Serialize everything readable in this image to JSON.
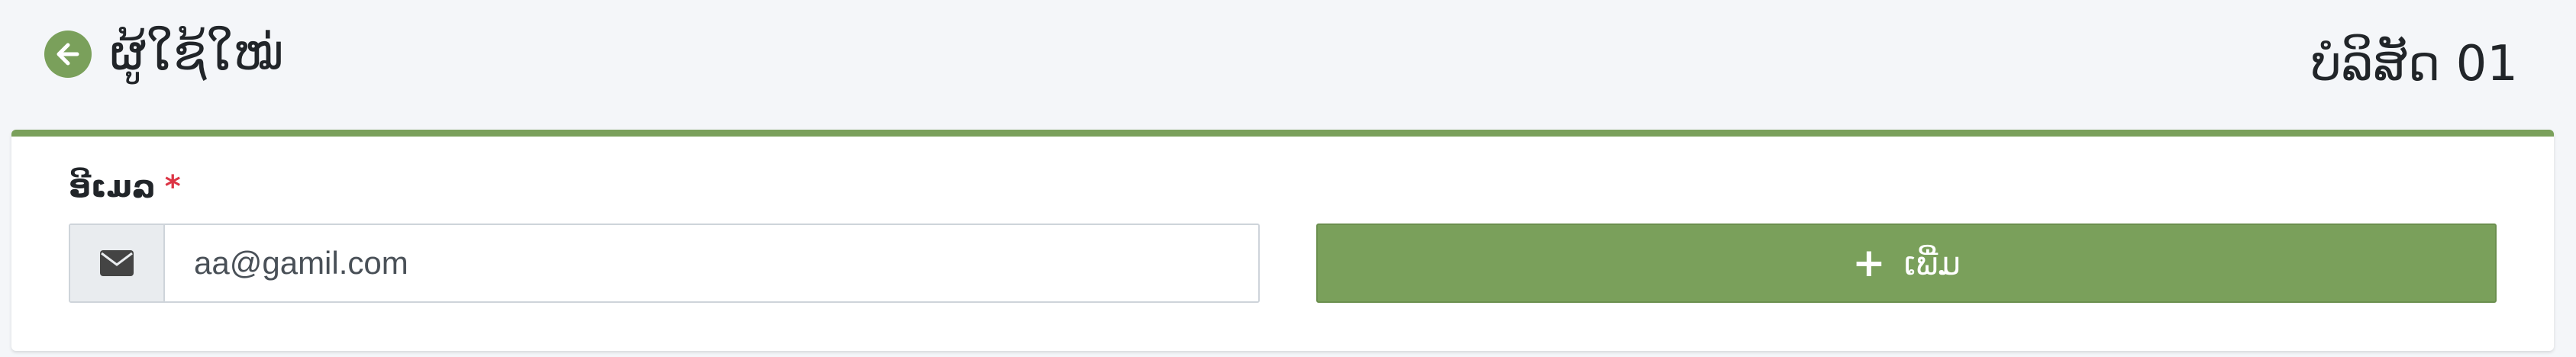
{
  "header": {
    "back_icon": "arrow-circle-left-icon",
    "title": "ຜູ້ໃຊ້ໃໝ່",
    "company": "ບໍລິສັດ 01"
  },
  "form": {
    "email_label": "ອີເມລ",
    "required_mark": "*",
    "email_icon": "envelope-icon",
    "email_value": "aa@gamil.com",
    "add_button": {
      "icon": "+",
      "label": "ເພີ່ມ"
    }
  },
  "colors": {
    "accent": "#7aa05b",
    "required": "#dc3545",
    "background": "#f4f6f9"
  }
}
